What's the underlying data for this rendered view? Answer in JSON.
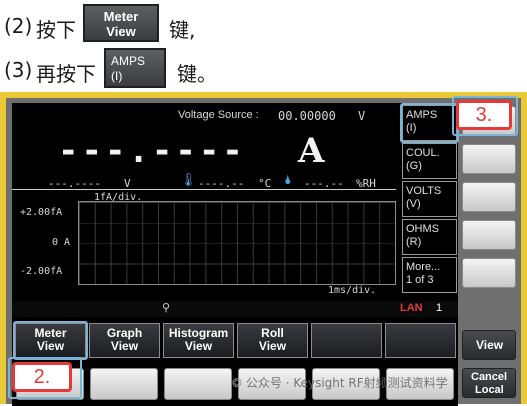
{
  "instructions": {
    "step2": {
      "num": "(2)",
      "text": "按下",
      "suffix": "键,",
      "key_line1": "Meter",
      "key_line2": "View"
    },
    "step3": {
      "num": "(3)",
      "text": "再按下",
      "suffix": "键。",
      "key_line1": "AMPS",
      "key_line2": "(I)"
    }
  },
  "screen": {
    "voltage_source_label": "Voltage Source :",
    "voltage_source_value": "00.00000",
    "voltage_source_unit": "V",
    "main_reading": "---.----",
    "main_unit": "A",
    "volt_reading": "---.----",
    "volt_unit": "V",
    "temp_reading": "----.--",
    "temp_unit": "°C",
    "humidity_reading": "---.--",
    "humidity_unit": "%RH",
    "graph_scale": "1fA/div.",
    "y_top": "+2.00fA",
    "y_mid": "0 A",
    "y_bot": "-2.00fA",
    "time_scale": "1ms/div.",
    "lan_label": "LAN",
    "lan_value": "1"
  },
  "right_softkeys": [
    {
      "line1": "AMPS",
      "line2": "(I)"
    },
    {
      "line1": "COUL.",
      "line2": "(G)"
    },
    {
      "line1": "VOLTS",
      "line2": "(V)"
    },
    {
      "line1": "OHMS",
      "line2": "(R)"
    },
    {
      "line1": "More...",
      "line2": "1 of 3"
    }
  ],
  "bottom_softkeys": [
    {
      "line1": "Meter",
      "line2": "View"
    },
    {
      "line1": "Graph",
      "line2": "View"
    },
    {
      "line1": "Histogram",
      "line2": "View"
    },
    {
      "line1": "Roll",
      "line2": "View"
    },
    {
      "line1": "",
      "line2": ""
    },
    {
      "line1": "",
      "line2": ""
    }
  ],
  "physical_keys": {
    "view_label": "View",
    "cancel_label": "Cancel",
    "local_label": "Local"
  },
  "callouts": {
    "step2": "2.",
    "step3": "3."
  },
  "watermark": "公众号 · Keysight RF射频测试资料学",
  "colors": {
    "bezel": "#e9c935",
    "callout": "#e63a3a",
    "highlight": "#7ab4d8"
  }
}
